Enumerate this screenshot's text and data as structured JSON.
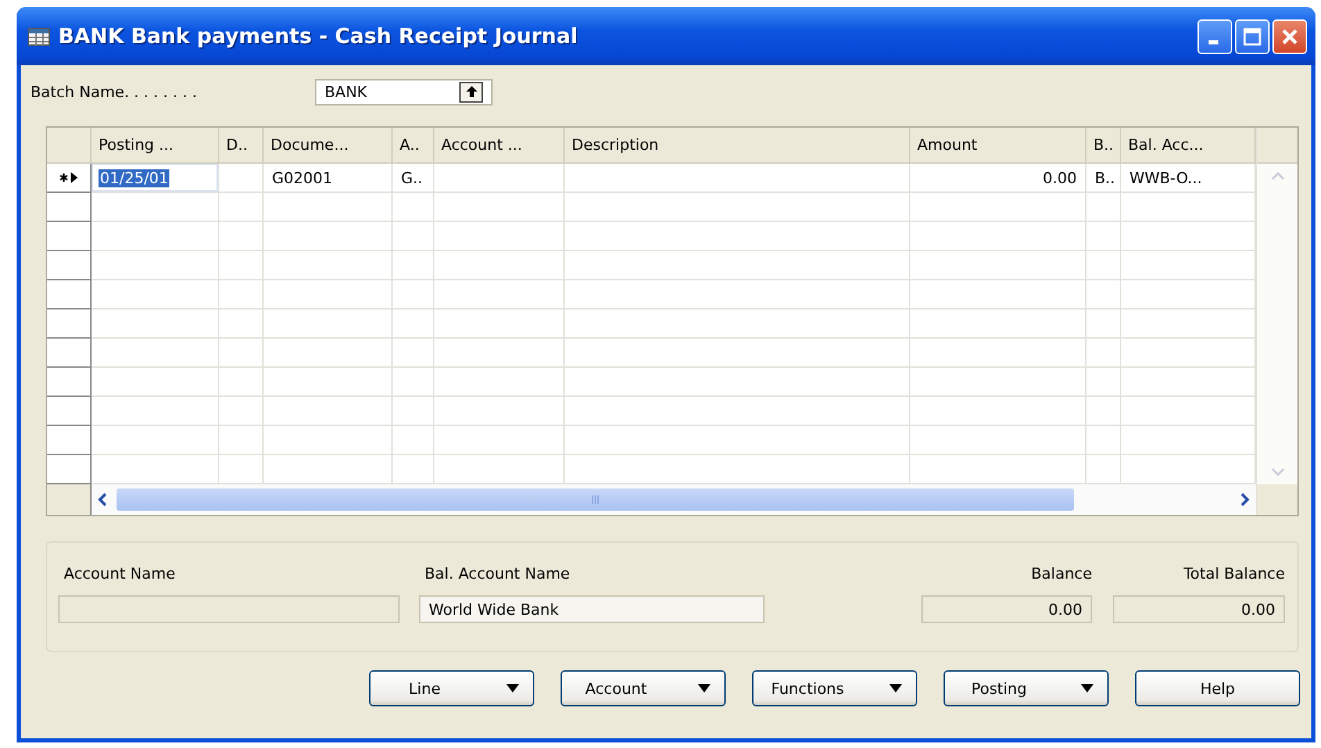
{
  "window": {
    "title": "BANK Bank payments - Cash Receipt Journal"
  },
  "batch": {
    "label": "Batch Name. . . . . . . .",
    "value": "BANK"
  },
  "table": {
    "columns": [
      {
        "label": "Posting ...",
        "kind": "text"
      },
      {
        "label": "D..",
        "kind": "text"
      },
      {
        "label": "Docume...",
        "kind": "text"
      },
      {
        "label": "A..",
        "kind": "text"
      },
      {
        "label": "Account ...",
        "kind": "text"
      },
      {
        "label": "Description",
        "kind": "text"
      },
      {
        "label": "Amount",
        "kind": "number"
      },
      {
        "label": "B..",
        "kind": "text"
      },
      {
        "label": "Bal. Acc...",
        "kind": "text"
      }
    ],
    "rows": [
      {
        "current": true,
        "cells": [
          {
            "text": "01/25/01",
            "selected": true
          },
          {
            "selected": false
          },
          {
            "text": "G02001",
            "selected": false
          },
          {
            "text": "G..",
            "selected": false
          },
          {
            "selected": false
          },
          {
            "selected": false
          },
          {
            "text": "0.00",
            "selected": false
          },
          {
            "text": "B..",
            "selected": false
          },
          {
            "text": "WWB-O...",
            "selected": false
          }
        ]
      }
    ]
  },
  "info": {
    "fields": [
      {
        "label": "Account Name",
        "kind": "text"
      },
      {
        "label": "Bal. Account Name",
        "value": "World Wide Bank",
        "kind": "text"
      },
      {
        "label": "Balance",
        "value": "0.00",
        "kind": "number"
      },
      {
        "label": "Total Balance",
        "value": "0.00",
        "kind": "number"
      }
    ]
  },
  "buttons": [
    {
      "label": "Line",
      "kind": "menu"
    },
    {
      "label": "Account",
      "kind": "menu"
    },
    {
      "label": "Functions",
      "kind": "menu"
    },
    {
      "label": "Posting",
      "kind": "menu"
    },
    {
      "label": "Help",
      "kind": "plain"
    }
  ]
}
